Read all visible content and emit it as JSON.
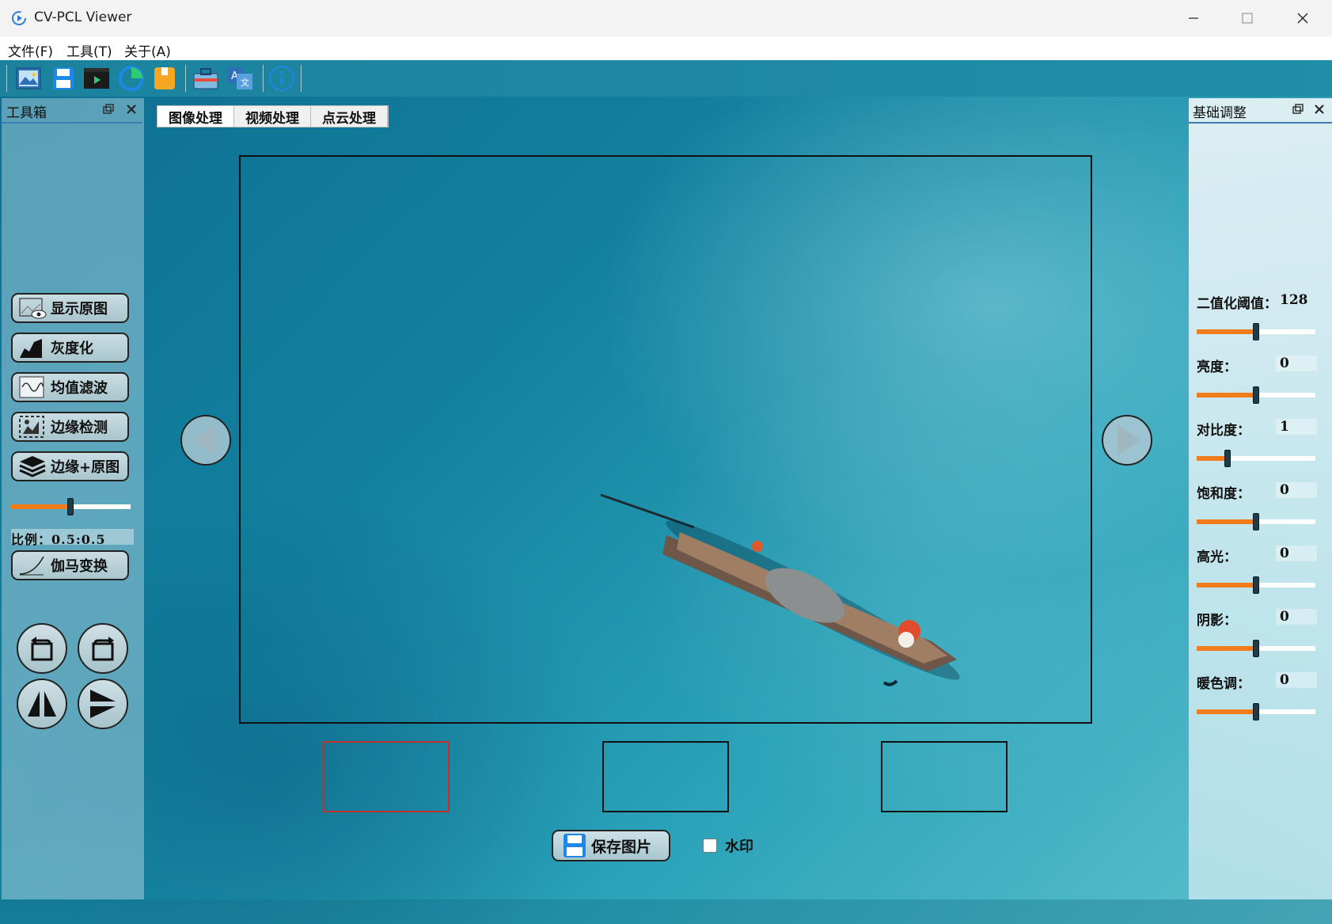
{
  "window": {
    "title": "CV-PCL Viewer"
  },
  "menu": {
    "items": [
      "文件(F)",
      "工具(T)",
      "关于(A)"
    ]
  },
  "toolbar": {
    "buttons": [
      "open-image-icon",
      "save-icon",
      "video-icon",
      "point-cloud-icon",
      "bookmark-icon",
      "toolbox-icon",
      "translate-icon",
      "info-icon"
    ]
  },
  "left_dock": {
    "title": "工具箱",
    "buttons": [
      {
        "label": "显示原图",
        "icon": "image-eye-icon"
      },
      {
        "label": "灰度化",
        "icon": "grayscale-icon"
      },
      {
        "label": "均值滤波",
        "icon": "wave-filter-icon"
      },
      {
        "label": "边缘检测",
        "icon": "edge-detect-icon"
      },
      {
        "label": "边缘+原图",
        "icon": "layers-icon"
      }
    ],
    "blend_slider": {
      "value": 0.5,
      "min": 0,
      "max": 1
    },
    "ratio_text": "比例：0.5:0.5",
    "gamma_button": {
      "label": "伽马变换",
      "icon": "gamma-curve-icon"
    },
    "transform_buttons": [
      "rotate-left-icon",
      "rotate-right-icon",
      "flip-horizontal-icon",
      "flip-vertical-icon"
    ]
  },
  "tabs": [
    "图像处理",
    "视频处理",
    "点云处理"
  ],
  "active_tab": "图像处理",
  "main": {
    "prev_icon": "arrow-left-icon",
    "next_icon": "arrow-right-icon",
    "save_button": "保存图片",
    "watermark_label": "水印",
    "watermark_checked": false
  },
  "right_dock": {
    "title": "基础调整",
    "adjustments": [
      {
        "label": "二值化阈值：",
        "value": "128",
        "fraction": 0.5
      },
      {
        "label": "亮度：",
        "value": "0",
        "fraction": 0.5
      },
      {
        "label": "对比度：",
        "value": "1",
        "fraction": 0.26
      },
      {
        "label": "饱和度：",
        "value": "0",
        "fraction": 0.5
      },
      {
        "label": "高光：",
        "value": "0",
        "fraction": 0.5
      },
      {
        "label": "阴影：",
        "value": "0",
        "fraction": 0.5
      },
      {
        "label": "暖色调：",
        "value": "0",
        "fraction": 0.5
      }
    ]
  },
  "colors": {
    "accent": "#f07c1c",
    "selected_thumb": "#c0312b"
  }
}
